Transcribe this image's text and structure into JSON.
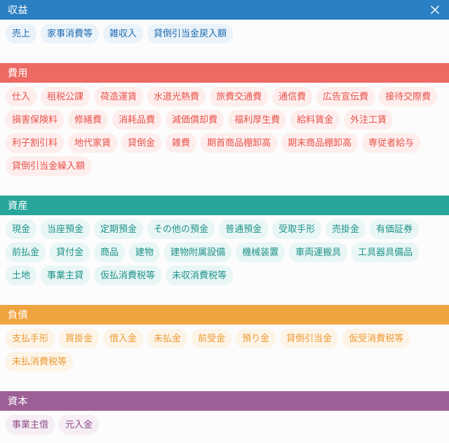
{
  "window": {
    "title": "収益",
    "close_label": "×",
    "close_icon": "close-icon",
    "header_color": "#2b7fc3"
  },
  "sections": [
    {
      "key": "revenue",
      "title": "収益",
      "color": "#2b7fc3",
      "pill_bg": "#eaf2fa",
      "pill_text": "#1f6cb0",
      "is_titlebar": true,
      "items": [
        "売上",
        "家事消費等",
        "雑収入",
        "貸倒引当金戻入額"
      ]
    },
    {
      "key": "expense",
      "title": "費用",
      "color": "#ec6a63",
      "pill_bg": "#fdeeed",
      "pill_text": "#e8534c",
      "is_titlebar": false,
      "items": [
        "仕入",
        "租税公課",
        "荷造運賃",
        "水道光熱費",
        "旅費交通費",
        "通信費",
        "広告宣伝費",
        "接待交際費",
        "損害保険料",
        "修繕費",
        "消耗品費",
        "減価償却費",
        "福利厚生費",
        "給料賃金",
        "外注工賃",
        "利子割引料",
        "地代家賃",
        "貸倒金",
        "雑費",
        "期首商品棚卸高",
        "期末商品棚卸高",
        "専従者給与",
        "貸倒引当金繰入額"
      ]
    },
    {
      "key": "assets",
      "title": "資産",
      "color": "#28a69b",
      "pill_bg": "#e8f6f5",
      "pill_text": "#1f9289",
      "is_titlebar": false,
      "items": [
        "現金",
        "当座預金",
        "定期預金",
        "その他の預金",
        "普通預金",
        "受取手形",
        "売掛金",
        "有価証券",
        "前払金",
        "貸付金",
        "商品",
        "建物",
        "建物附属設備",
        "機械装置",
        "車両運搬具",
        "工具器具備品",
        "土地",
        "事業主貸",
        "仮払消費税等",
        "未収消費税等"
      ]
    },
    {
      "key": "liabilities",
      "title": "負債",
      "color": "#f0a440",
      "pill_bg": "#fdf4e8",
      "pill_text": "#eb9b33",
      "is_titlebar": false,
      "items": [
        "支払手形",
        "買掛金",
        "借入金",
        "未払金",
        "前受金",
        "預り金",
        "貸倒引当金",
        "仮受消費税等",
        "未払消費税等"
      ]
    },
    {
      "key": "capital",
      "title": "資本",
      "color": "#9c5f96",
      "pill_bg": "#f5eef4",
      "pill_text": "#8e4f88",
      "is_titlebar": false,
      "items": [
        "事業主借",
        "元入金"
      ]
    }
  ]
}
